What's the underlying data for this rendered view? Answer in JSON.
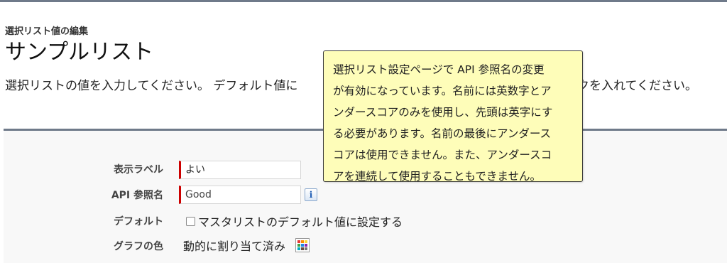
{
  "header": {
    "breadcrumb": "選択リスト値の編集",
    "title": "サンプルリスト",
    "instruction": "選択リストの値を入力してください。 デフォルト値に",
    "instruction_tail": "クを入れてください。"
  },
  "form": {
    "display_label": {
      "label": "表示ラベル",
      "value": "よい"
    },
    "api_name": {
      "label": "API 参照名",
      "value": "Good",
      "info_icon": "i"
    },
    "default": {
      "label": "デフォルト",
      "checkbox_label": "マスタリストのデフォルト値に設定する",
      "checked": false
    },
    "graph_color": {
      "label": "グラフの色",
      "value": "動的に割り当て済み",
      "icon": "color-palette-icon"
    }
  },
  "tooltip": {
    "lines": [
      "選択リスト設定ページで API 参照名の変更",
      "が有効になっています。名前には英数字とア",
      "ンダースコアのみを使用し、先頭は英字にす",
      "る必要があります。名前の最後にアンダース",
      "コアは使用できません。また、アンダースコ",
      "アを連続して使用することもできません。"
    ]
  },
  "colors": {
    "accent_rule": "#6f7a8a",
    "required_marker": "#cc0000",
    "tooltip_bg": "#fefdb9",
    "palette": [
      "#e53935",
      "#fb8c00",
      "#fdd835",
      "#43a047",
      "#1e88e5",
      "#8e24aa",
      "#00acc1",
      "#6d4c41",
      "#757575"
    ]
  }
}
